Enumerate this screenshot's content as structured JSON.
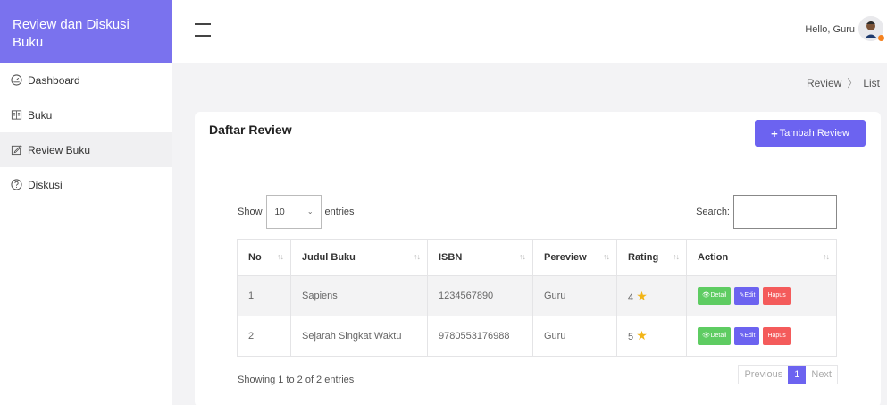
{
  "sidebar": {
    "brand": "Review dan Diskusi Buku",
    "items": [
      {
        "label": "Dashboard",
        "icon": "gauge-icon"
      },
      {
        "label": "Buku",
        "icon": "book-icon"
      },
      {
        "label": "Review Buku",
        "icon": "edit-icon"
      },
      {
        "label": "Diskusi",
        "icon": "help-circle-icon"
      }
    ],
    "active_index": 2
  },
  "topbar": {
    "greeting": "Hello, Guru"
  },
  "breadcrumb": {
    "parent": "Review",
    "current": "List"
  },
  "card": {
    "title": "Daftar Review",
    "add_button": "Tambah Review"
  },
  "table_controls": {
    "show_label": "Show",
    "entries_value": "10",
    "entries_label": "entries",
    "search_label": "Search:"
  },
  "table": {
    "columns": [
      "No",
      "Judul Buku",
      "ISBN",
      "Pereview",
      "Rating",
      "Action"
    ],
    "rows": [
      {
        "no": "1",
        "judul": "Sapiens",
        "isbn": "1234567890",
        "pereview": "Guru",
        "rating": "4"
      },
      {
        "no": "2",
        "judul": "Sejarah Singkat Waktu",
        "isbn": "9780553176988",
        "pereview": "Guru",
        "rating": "5"
      }
    ],
    "actions": {
      "detail": "Detail",
      "edit": "Edit",
      "hapus": "Hapus"
    }
  },
  "footer": {
    "info": "Showing 1 to 2 of 2 entries",
    "previous": "Previous",
    "page": "1",
    "next": "Next"
  },
  "colors": {
    "brand": "#7a72ee",
    "primary": "#6c63f0",
    "success": "#5ecc62",
    "danger": "#f45b5b",
    "star": "#f2b518"
  }
}
